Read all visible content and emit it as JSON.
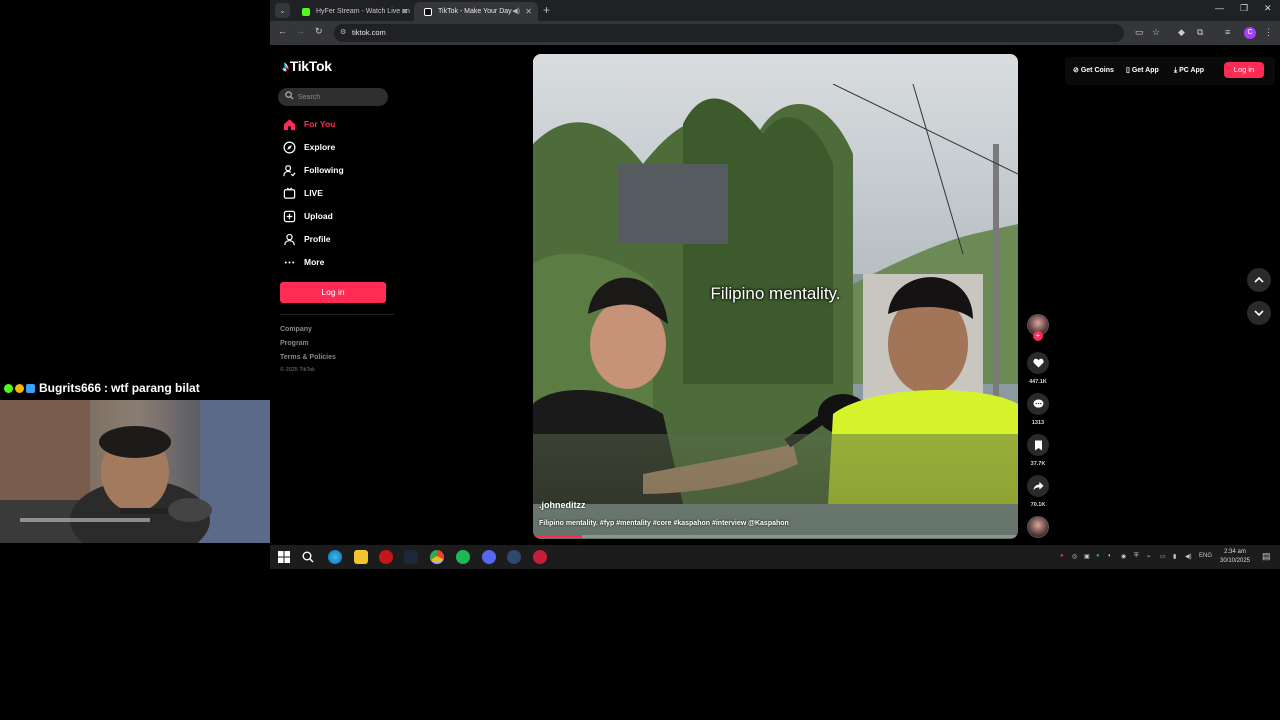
{
  "browser": {
    "tabs": [
      {
        "title": "HyFer Stream - Watch Live on",
        "favicon_color": "#53fc18"
      },
      {
        "title": "TikTok - Make Your Day",
        "favicon_color": "#ffffff"
      }
    ],
    "url": "tiktok.com"
  },
  "tiktok": {
    "logo": "TikTok",
    "search_placeholder": "Search",
    "nav": [
      {
        "label": "For You",
        "icon": "home-icon",
        "active": true
      },
      {
        "label": "Explore",
        "icon": "compass-icon"
      },
      {
        "label": "Following",
        "icon": "following-icon"
      },
      {
        "label": "LIVE",
        "icon": "live-icon"
      },
      {
        "label": "Upload",
        "icon": "upload-icon"
      },
      {
        "label": "Profile",
        "icon": "profile-icon"
      },
      {
        "label": "More",
        "icon": "more-icon"
      }
    ],
    "sidebar_login": "Log in",
    "footer_links": [
      "Company",
      "Program",
      "Terms & Policies"
    ],
    "copyright": "© 2025 TikTok",
    "top_actions": {
      "get_coins": "Get Coins",
      "get_app": "Get App",
      "pc_app": "PC App",
      "login": "Log in"
    },
    "video": {
      "overlay_text": "Filipino mentality.",
      "author": ".johneditzz",
      "description": "Filipino mentality. #fyp #mentality #core #kaspahon #interview @Kaspahon",
      "progress": 0.1
    },
    "actions": {
      "likes": "447.1K",
      "comments": "1313",
      "saves": "37.7K",
      "shares": "70.1K"
    }
  },
  "taskbar": {
    "lang": "ENG",
    "time": "2:34 am",
    "date": "30/10/2025"
  },
  "stream_overlay": {
    "chat_user": "Bugrits666",
    "chat_separator": ":",
    "chat_message": "wtf parang bilat"
  },
  "colors": {
    "accent": "#fe2c55",
    "kick_green": "#53fc18"
  }
}
